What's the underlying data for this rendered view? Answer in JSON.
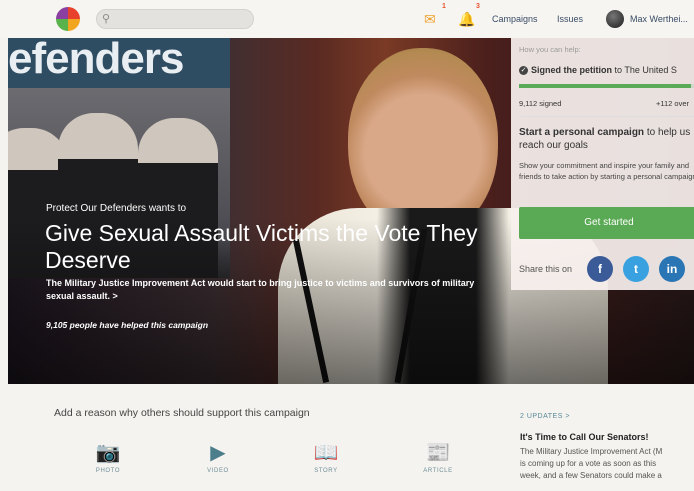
{
  "topbar": {
    "search_icon": "search-icon",
    "notif_count_1": "1",
    "notif_count_2": "3",
    "campaigns_label": "Campaigns",
    "issues_label": "Issues",
    "username": "Max Werthei..."
  },
  "hero": {
    "poster_title": "efenders",
    "supertitle": "Protect Our Defenders wants to",
    "title": "Give Sexual Assault Victims the Vote They Deserve",
    "description": "The Military Justice Improvement Act would start to bring justice to victims and survivors of military sexual assault. >",
    "helped_count": "9,105 people have helped this campaign"
  },
  "panel": {
    "help_label": "How you can help:",
    "signed_bold": "Signed the petition",
    "signed_rest": " to The United S",
    "progress": 0.98,
    "signed_count": "9,112 signed",
    "over_count": "+112 over",
    "pc_bold": "Start a personal campaign",
    "pc_rest": " to help us reach our goals",
    "pc_desc": "Show your commitment and inspire your family and friends to take action by starting a personal campaign.",
    "cta_label": "Get started",
    "share_label": "Share this on"
  },
  "social": [
    {
      "label": "f",
      "color": "#3b5b98"
    },
    {
      "label": "t",
      "color": "#3aa1e0"
    },
    {
      "label": "in",
      "color": "#2a75b3"
    }
  ],
  "lower": {
    "reason_prompt": "Add a reason why others should support this campaign",
    "media": [
      {
        "label": "PHOTO",
        "icon": "camera-icon"
      },
      {
        "label": "VIDEO",
        "icon": "youtube-icon"
      },
      {
        "label": "STORY",
        "icon": "book-icon"
      },
      {
        "label": "ARTICLE",
        "icon": "newspaper-icon"
      }
    ],
    "updates_label": "2 UPDATES >",
    "update_title": "It's Time to Call Our Senators!",
    "update_lines": [
      "The Military Justice Improvement Act (M",
      "is coming up for a vote as soon as this",
      "week, and a few Senators could make a"
    ]
  }
}
